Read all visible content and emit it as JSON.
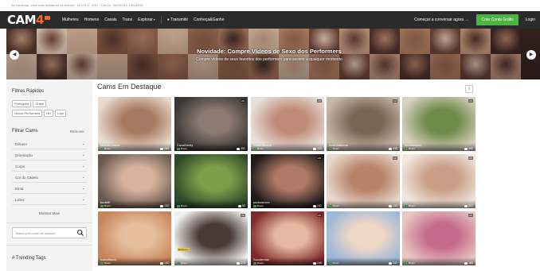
{
  "top_notice": "Ao continuar, você está aceitando os termos · 18 U.S.C. 2257 · DMCA · AVISO AO USUÁRIO",
  "logo": {
    "text": "CAM",
    "four": "4",
    "icon": "cam4-badge-icon"
  },
  "nav": {
    "items": [
      {
        "label": "Mulheres",
        "caret": false
      },
      {
        "label": "Homens",
        "caret": false
      },
      {
        "label": "Casais",
        "caret": false
      },
      {
        "label": "Trans",
        "caret": false
      },
      {
        "label": "Explorar",
        "caret": true
      },
      {
        "label": "Transmitir",
        "caret": false,
        "icon": "broadcast-icon"
      },
      {
        "label": "Conheça&Ganhe",
        "caret": false
      }
    ],
    "start_stream": "Começar a conversar agora →",
    "signup_label": "Criar Conta Grátis",
    "login_label": "Login",
    "signup_color": "#4cb53f"
  },
  "banner": {
    "title": "Novidade: Compre Vídeos de Sexo dos Performers",
    "subtitle": "Compre vídeos de seus favoritos dos performers para assistir a qualquer momento",
    "prev_icon": "chevron-left-icon",
    "next_icon": "chevron-right-icon"
  },
  "sidebar": {
    "quick_filters_title": "Filtros Rápidos",
    "quick_chips_row1": [
      "Português",
      "Grátis"
    ],
    "quick_chips_row2": [
      "Novos Performers",
      "HD",
      "Loja"
    ],
    "filter_title": "Filtrar Cams",
    "clear_label": "Remover",
    "filters": [
      "Gênero",
      "Orientação",
      "Corpo",
      "Cor do Cabelo",
      "Etnia",
      "Lazer"
    ],
    "show_more": "Mostrar Mais",
    "search_placeholder": "Busca por nome de usuário",
    "trending_title": "# Trending Tags"
  },
  "main": {
    "title": "Cams Em Destaque",
    "view_toggle_icon": "grid-view-icon",
    "cams": [
      {
        "name": "Melhor prazer",
        "location": "Brasil",
        "viewers": "265",
        "hd": false,
        "tag": ""
      },
      {
        "name": "CoxaEdelly",
        "location": "Brasil",
        "viewers": "301",
        "hd": true,
        "tag": ""
      },
      {
        "name": "VickieBluebb",
        "location": "Brasil",
        "viewers": "125",
        "hd": true,
        "tag": ""
      },
      {
        "name": "novinhaduma",
        "location": "Brasil",
        "viewers": "535",
        "hd": true,
        "tag": ""
      },
      {
        "name": "femmeluxxe",
        "location": "Brasil",
        "viewers": "193",
        "hd": true,
        "tag": ""
      },
      {
        "name": "bedeffi",
        "location": "Brasil",
        "viewers": "132",
        "hd": false,
        "tag": ""
      },
      {
        "name": "",
        "location": "Brasil",
        "viewers": "83",
        "hd": false,
        "tag": ""
      },
      {
        "name": "pedrosexxx",
        "location": "Brasil",
        "viewers": "241",
        "hd": true,
        "tag": ""
      },
      {
        "name": "",
        "location": "Brasil",
        "viewers": "110",
        "hd": true,
        "tag": ""
      },
      {
        "name": "",
        "location": "Brasil",
        "viewers": "207",
        "hd": true,
        "tag": ""
      },
      {
        "name": "hotmilfbuck",
        "location": "Brasil",
        "viewers": "143",
        "hd": false,
        "tag": ""
      },
      {
        "name": "",
        "location": "Brasil",
        "viewers": "373",
        "hd": true,
        "tag": "Exclusivo"
      },
      {
        "name": "Suculentas",
        "location": "Brasil",
        "viewers": "249",
        "hd": true,
        "tag": ""
      },
      {
        "name": "",
        "location": "Brasil",
        "viewers": "141",
        "hd": false,
        "tag": ""
      },
      {
        "name": "",
        "location": "Brasil",
        "viewers": "155",
        "hd": true,
        "tag": ""
      }
    ]
  }
}
